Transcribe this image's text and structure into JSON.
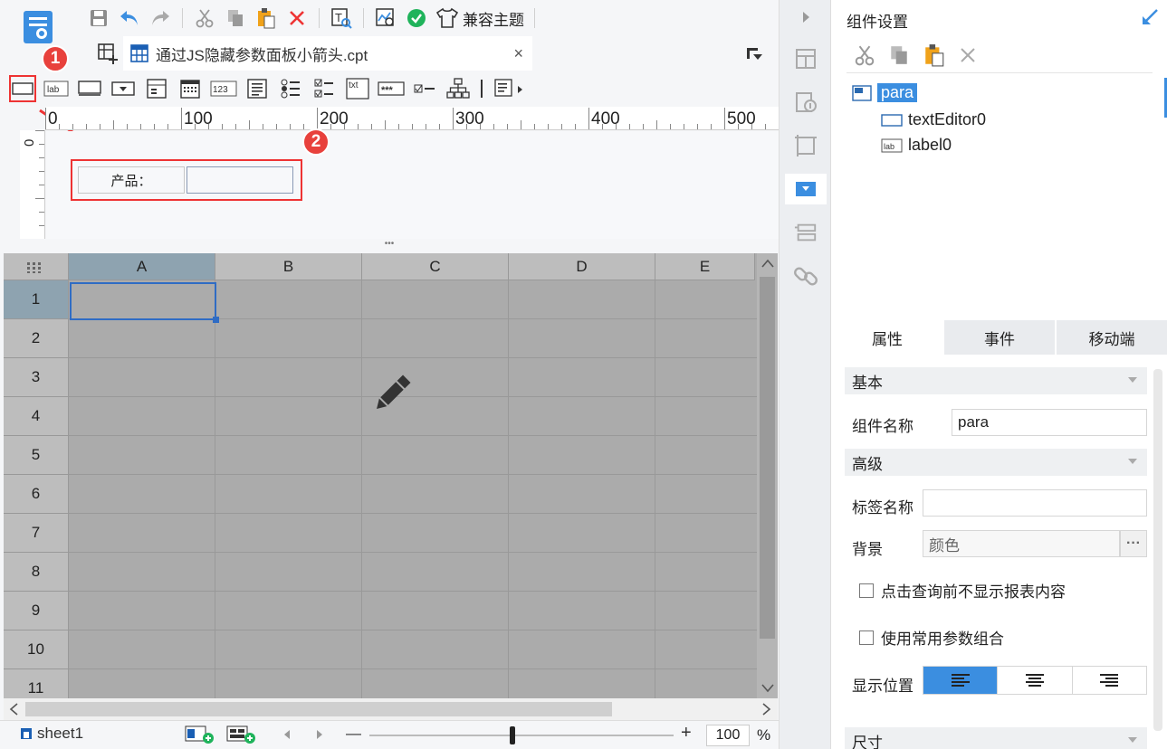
{
  "toolbar": {
    "theme_label": "兼容主题"
  },
  "tab": {
    "filename": "通过JS隐藏参数面板小箭头.cpt",
    "close": "×"
  },
  "widget_palette": {
    "label_icon_text": "lab",
    "number_icon_text": "123",
    "txt_icon_text": "txt",
    "password_icon_text": "***"
  },
  "annotations": {
    "badge1": "1",
    "badge2": "2"
  },
  "ruler": {
    "h_labels": [
      "0",
      "100",
      "200",
      "300",
      "400",
      "500"
    ],
    "v_label": "0"
  },
  "param_panel": {
    "label_text": "产品："
  },
  "sheet": {
    "columns": [
      "A",
      "B",
      "C",
      "D",
      "E"
    ],
    "rows": [
      "1",
      "2",
      "3",
      "4",
      "5",
      "6",
      "7",
      "8",
      "9",
      "10",
      "11"
    ],
    "selected_cell": "A1"
  },
  "status": {
    "sheet_name": "sheet1",
    "zoom_value": "100",
    "zoom_pct": "%",
    "minus": "—",
    "plus": "+"
  },
  "right_panel": {
    "title": "组件设置",
    "tree": {
      "root": "para",
      "children": [
        "textEditor0",
        "label0"
      ]
    },
    "tabs": [
      "属性",
      "事件",
      "移动端"
    ],
    "sections": {
      "basic": "基本",
      "advanced": "高级",
      "size": "尺寸"
    },
    "fields": {
      "component_name_label": "组件名称",
      "component_name_value": "para",
      "tag_name_label": "标签名称",
      "tag_name_value": "",
      "background_label": "背景",
      "background_value": "颜色",
      "background_more": "···",
      "checkbox1": "点击查询前不显示报表内容",
      "checkbox2": "使用常用参数组合",
      "display_pos_label": "显示位置"
    }
  },
  "colors": {
    "accent": "#3b8ee0",
    "highlight_red": "#e8413c",
    "sheet_bg": "#ababab",
    "selection": "#2f6cc4"
  }
}
